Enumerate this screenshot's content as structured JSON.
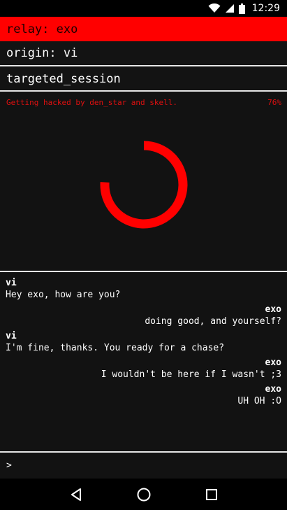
{
  "status_bar": {
    "time": "12:29",
    "icons": [
      "wifi-icon",
      "cell-signal-icon",
      "battery-icon"
    ]
  },
  "header": {
    "relay": "relay: exo",
    "origin": "origin: vi",
    "session": "targeted_session"
  },
  "hack": {
    "message": "Getting hacked by den_star and skell.",
    "percent_text": "76%",
    "progress": 0.76
  },
  "chat": {
    "messages": [
      {
        "sender": "vi",
        "text": "Hey exo, how are you?",
        "align": "left"
      },
      {
        "sender": "exo",
        "text": "doing good, and yourself?",
        "align": "right"
      },
      {
        "sender": "vi",
        "text": "I'm fine, thanks. You ready for a chase?",
        "align": "left"
      },
      {
        "sender": "exo",
        "text": "I wouldn't be here if I wasn't ;3",
        "align": "right"
      },
      {
        "sender": "exo",
        "text": "UH OH :O",
        "align": "right"
      }
    ]
  },
  "input": {
    "prompt": ">",
    "value": ""
  },
  "nav": {
    "icons": [
      "back-icon",
      "home-icon",
      "recents-icon"
    ]
  },
  "colors": {
    "accent": "#ff0000",
    "background": "#121212",
    "divider": "#e6e6e6"
  }
}
